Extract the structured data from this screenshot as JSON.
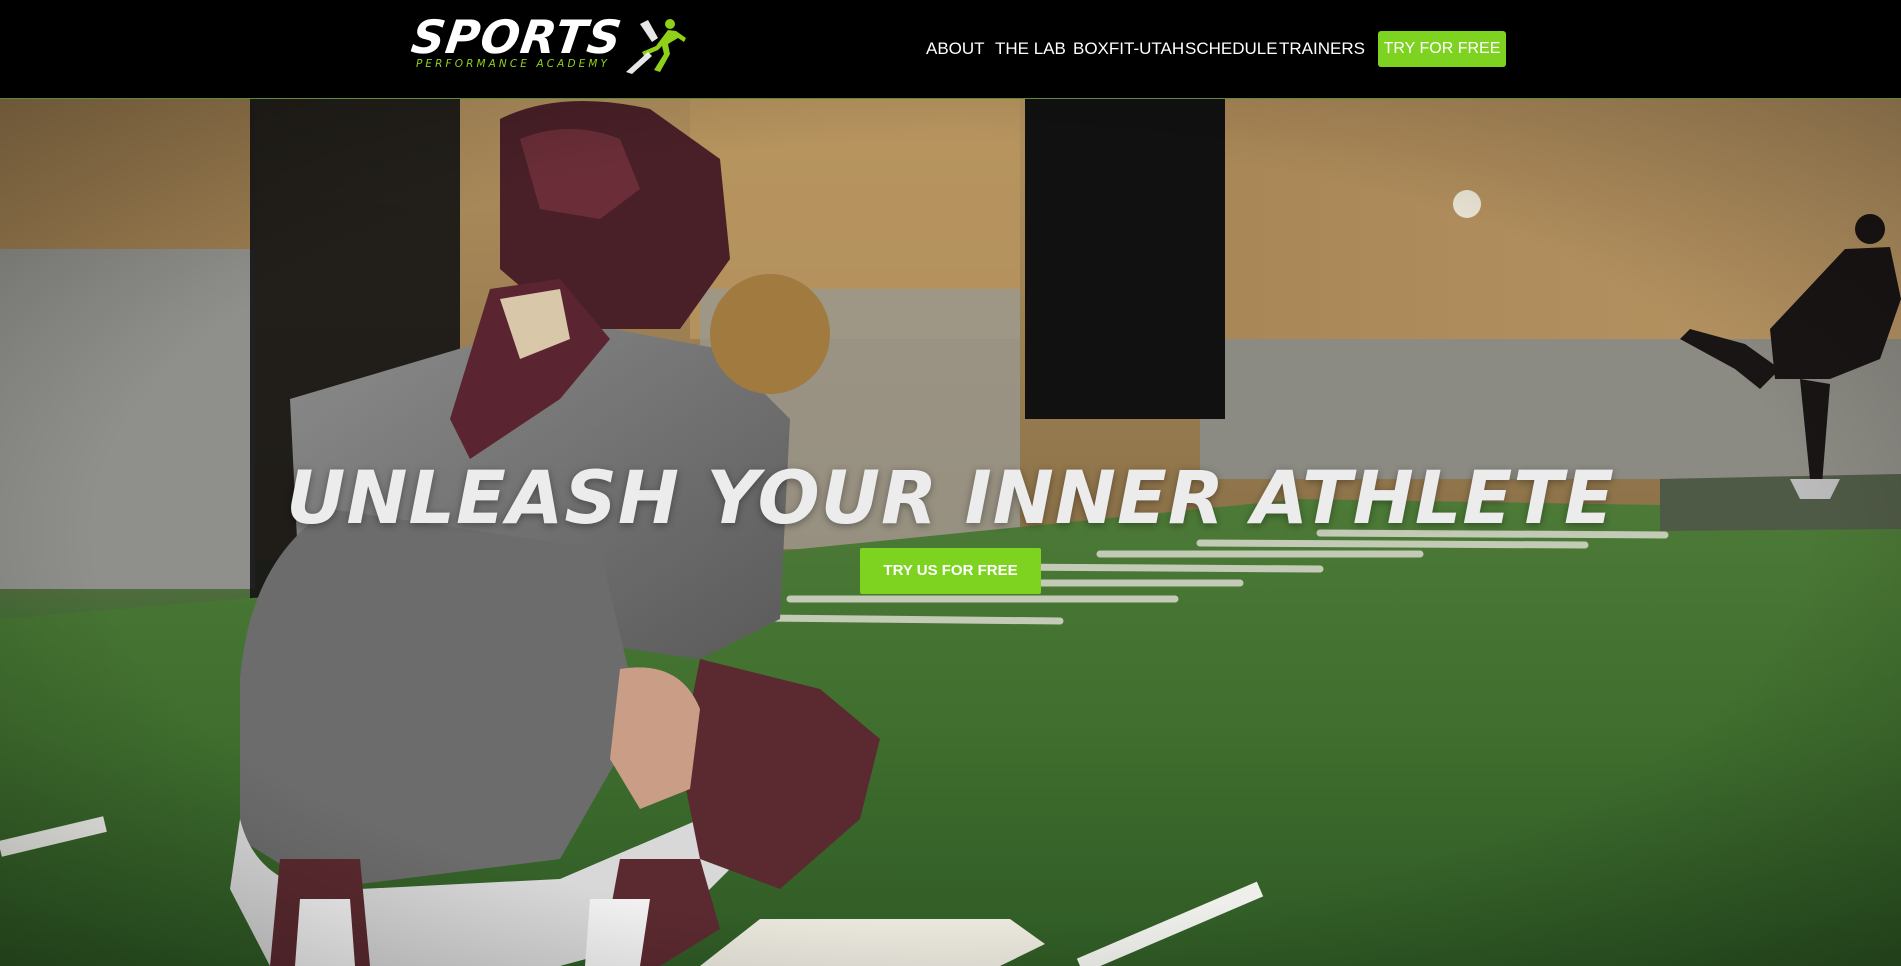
{
  "header": {
    "logo": {
      "wordmark": "SPORTS",
      "tagline": "PERFORMANCE ACADEMY",
      "icon": "runner-icon"
    },
    "nav": [
      {
        "label": "ABOUT"
      },
      {
        "label": "THE LAB"
      },
      {
        "label": "BOXFIT-UTAH"
      },
      {
        "label": "SCHEDULE"
      },
      {
        "label": "TRAINERS"
      }
    ],
    "cta_label": "TRY FOR FREE"
  },
  "hero": {
    "headline": "UNLEASH YOUR INNER ATHLETE",
    "button_label": "TRY US FOR FREE"
  },
  "colors": {
    "accent": "#7ed321",
    "header_bg": "#000000",
    "header_border": "#5f8a3a",
    "text": "#ffffff"
  }
}
